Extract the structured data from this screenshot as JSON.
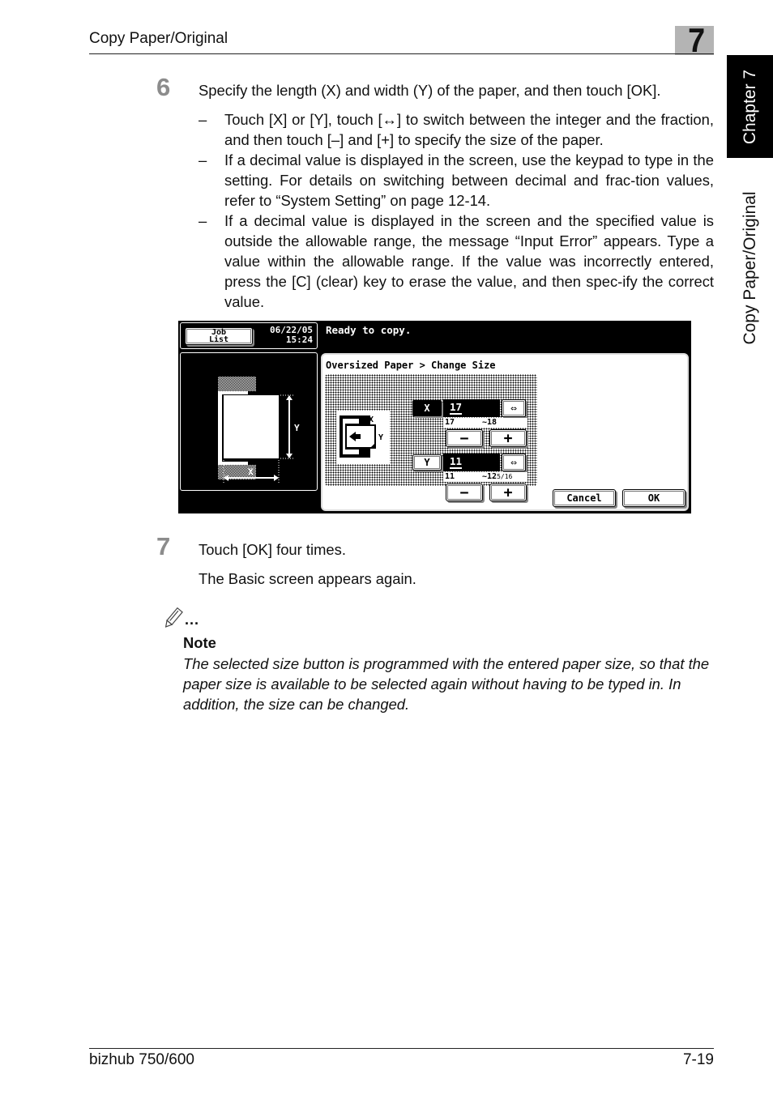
{
  "header": {
    "section_title": "Copy Paper/Original",
    "chapter_number": "7"
  },
  "side_tab": {
    "chapter_label": "Chapter 7",
    "section_label": "Copy Paper/Original"
  },
  "step6": {
    "number": "6",
    "text": "Specify the length (X) and width (Y) of the paper, and then touch [OK].",
    "bullets": [
      {
        "dash": "–",
        "text": "Touch [X] or [Y], touch [↔] to switch between the integer and the fraction, and then touch [–] and [+] to specify the size of the paper."
      },
      {
        "dash": "–",
        "text": "If a decimal value is displayed in the screen, use the keypad to type in the setting. For details on switching between decimal and frac-tion values, refer to “System Setting” on page 12-14."
      },
      {
        "dash": "–",
        "text": "If a decimal value is displayed in the screen and the specified value is outside the allowable range, the message “Input Error” appears. Type a value within the allowable range. If the value was incorrectly entered, press the [C] (clear) key to erase the value, and then spec-ify the correct value."
      }
    ]
  },
  "screen": {
    "job_list_line1": "Job",
    "job_list_line2": "List",
    "date": "06/22/05",
    "time": "15:24",
    "status": "Ready to copy.",
    "dialog_title": "Oversized Paper > Change Size",
    "diagram_x_label": "X",
    "diagram_y_label": "Y",
    "x": {
      "button_label": "X",
      "value": "17",
      "toggle_icon": "⇔",
      "range_min": "17",
      "range_max_prefix": "~",
      "range_max": "18",
      "range_max_fraction": "",
      "minus": "−",
      "plus": "+"
    },
    "y": {
      "button_label": "Y",
      "value": "11",
      "toggle_icon": "⇔",
      "range_min": "11",
      "range_max_prefix": "~",
      "range_max": "12",
      "range_max_fraction": "5/16",
      "minus": "−",
      "plus": "+"
    },
    "cancel_label": "Cancel",
    "ok_label": "OK"
  },
  "step7": {
    "number": "7",
    "text": "Touch [OK] four times.",
    "result": "The Basic screen appears again."
  },
  "note": {
    "icon": "pencil-icon",
    "dots": "...",
    "label": "Note",
    "text": "The selected size button is programmed with the entered paper size, so that the paper size is available to be selected again without having to be typed in. In addition, the size can be changed."
  },
  "footer": {
    "product": "bizhub 750/600",
    "page": "7-19"
  }
}
